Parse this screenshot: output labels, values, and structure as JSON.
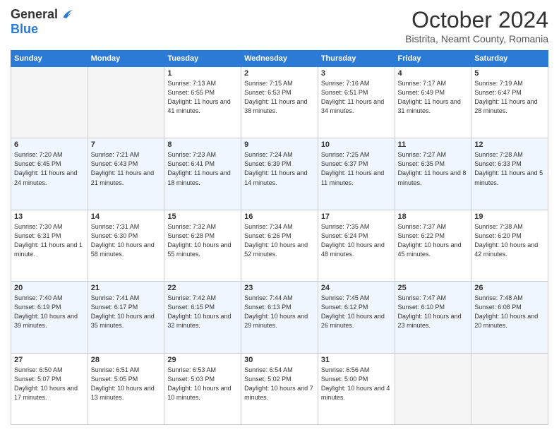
{
  "header": {
    "logo_line1": "General",
    "logo_line2": "Blue",
    "month_title": "October 2024",
    "location": "Bistrita, Neamt County, Romania"
  },
  "weekdays": [
    "Sunday",
    "Monday",
    "Tuesday",
    "Wednesday",
    "Thursday",
    "Friday",
    "Saturday"
  ],
  "weeks": [
    [
      {
        "day": "",
        "info": ""
      },
      {
        "day": "",
        "info": ""
      },
      {
        "day": "1",
        "info": "Sunrise: 7:13 AM\nSunset: 6:55 PM\nDaylight: 11 hours and 41 minutes."
      },
      {
        "day": "2",
        "info": "Sunrise: 7:15 AM\nSunset: 6:53 PM\nDaylight: 11 hours and 38 minutes."
      },
      {
        "day": "3",
        "info": "Sunrise: 7:16 AM\nSunset: 6:51 PM\nDaylight: 11 hours and 34 minutes."
      },
      {
        "day": "4",
        "info": "Sunrise: 7:17 AM\nSunset: 6:49 PM\nDaylight: 11 hours and 31 minutes."
      },
      {
        "day": "5",
        "info": "Sunrise: 7:19 AM\nSunset: 6:47 PM\nDaylight: 11 hours and 28 minutes."
      }
    ],
    [
      {
        "day": "6",
        "info": "Sunrise: 7:20 AM\nSunset: 6:45 PM\nDaylight: 11 hours and 24 minutes."
      },
      {
        "day": "7",
        "info": "Sunrise: 7:21 AM\nSunset: 6:43 PM\nDaylight: 11 hours and 21 minutes."
      },
      {
        "day": "8",
        "info": "Sunrise: 7:23 AM\nSunset: 6:41 PM\nDaylight: 11 hours and 18 minutes."
      },
      {
        "day": "9",
        "info": "Sunrise: 7:24 AM\nSunset: 6:39 PM\nDaylight: 11 hours and 14 minutes."
      },
      {
        "day": "10",
        "info": "Sunrise: 7:25 AM\nSunset: 6:37 PM\nDaylight: 11 hours and 11 minutes."
      },
      {
        "day": "11",
        "info": "Sunrise: 7:27 AM\nSunset: 6:35 PM\nDaylight: 11 hours and 8 minutes."
      },
      {
        "day": "12",
        "info": "Sunrise: 7:28 AM\nSunset: 6:33 PM\nDaylight: 11 hours and 5 minutes."
      }
    ],
    [
      {
        "day": "13",
        "info": "Sunrise: 7:30 AM\nSunset: 6:31 PM\nDaylight: 11 hours and 1 minute."
      },
      {
        "day": "14",
        "info": "Sunrise: 7:31 AM\nSunset: 6:30 PM\nDaylight: 10 hours and 58 minutes."
      },
      {
        "day": "15",
        "info": "Sunrise: 7:32 AM\nSunset: 6:28 PM\nDaylight: 10 hours and 55 minutes."
      },
      {
        "day": "16",
        "info": "Sunrise: 7:34 AM\nSunset: 6:26 PM\nDaylight: 10 hours and 52 minutes."
      },
      {
        "day": "17",
        "info": "Sunrise: 7:35 AM\nSunset: 6:24 PM\nDaylight: 10 hours and 48 minutes."
      },
      {
        "day": "18",
        "info": "Sunrise: 7:37 AM\nSunset: 6:22 PM\nDaylight: 10 hours and 45 minutes."
      },
      {
        "day": "19",
        "info": "Sunrise: 7:38 AM\nSunset: 6:20 PM\nDaylight: 10 hours and 42 minutes."
      }
    ],
    [
      {
        "day": "20",
        "info": "Sunrise: 7:40 AM\nSunset: 6:19 PM\nDaylight: 10 hours and 39 minutes."
      },
      {
        "day": "21",
        "info": "Sunrise: 7:41 AM\nSunset: 6:17 PM\nDaylight: 10 hours and 35 minutes."
      },
      {
        "day": "22",
        "info": "Sunrise: 7:42 AM\nSunset: 6:15 PM\nDaylight: 10 hours and 32 minutes."
      },
      {
        "day": "23",
        "info": "Sunrise: 7:44 AM\nSunset: 6:13 PM\nDaylight: 10 hours and 29 minutes."
      },
      {
        "day": "24",
        "info": "Sunrise: 7:45 AM\nSunset: 6:12 PM\nDaylight: 10 hours and 26 minutes."
      },
      {
        "day": "25",
        "info": "Sunrise: 7:47 AM\nSunset: 6:10 PM\nDaylight: 10 hours and 23 minutes."
      },
      {
        "day": "26",
        "info": "Sunrise: 7:48 AM\nSunset: 6:08 PM\nDaylight: 10 hours and 20 minutes."
      }
    ],
    [
      {
        "day": "27",
        "info": "Sunrise: 6:50 AM\nSunset: 5:07 PM\nDaylight: 10 hours and 17 minutes."
      },
      {
        "day": "28",
        "info": "Sunrise: 6:51 AM\nSunset: 5:05 PM\nDaylight: 10 hours and 13 minutes."
      },
      {
        "day": "29",
        "info": "Sunrise: 6:53 AM\nSunset: 5:03 PM\nDaylight: 10 hours and 10 minutes."
      },
      {
        "day": "30",
        "info": "Sunrise: 6:54 AM\nSunset: 5:02 PM\nDaylight: 10 hours and 7 minutes."
      },
      {
        "day": "31",
        "info": "Sunrise: 6:56 AM\nSunset: 5:00 PM\nDaylight: 10 hours and 4 minutes."
      },
      {
        "day": "",
        "info": ""
      },
      {
        "day": "",
        "info": ""
      }
    ]
  ]
}
